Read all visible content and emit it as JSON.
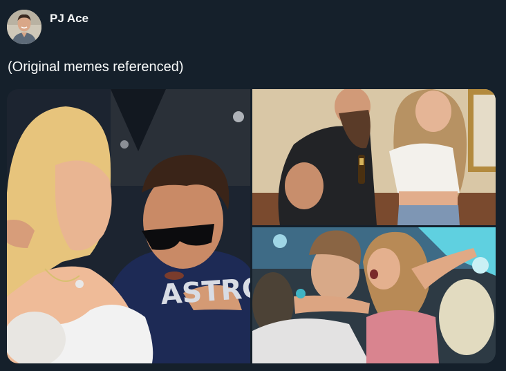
{
  "author": {
    "display_name": "PJ Ace",
    "avatar_icon": "profile-photo"
  },
  "tweet": {
    "text": "(Original memes referenced)"
  },
  "media": {
    "shirt_lettering": "ASTROS",
    "photos": [
      {
        "name": "photo-stadium-couple"
      },
      {
        "name": "photo-bearded-man-and-woman"
      },
      {
        "name": "photo-concert-couple"
      }
    ]
  },
  "colors": {
    "background": "#15202b",
    "text_primary": "#f7f9f9"
  }
}
